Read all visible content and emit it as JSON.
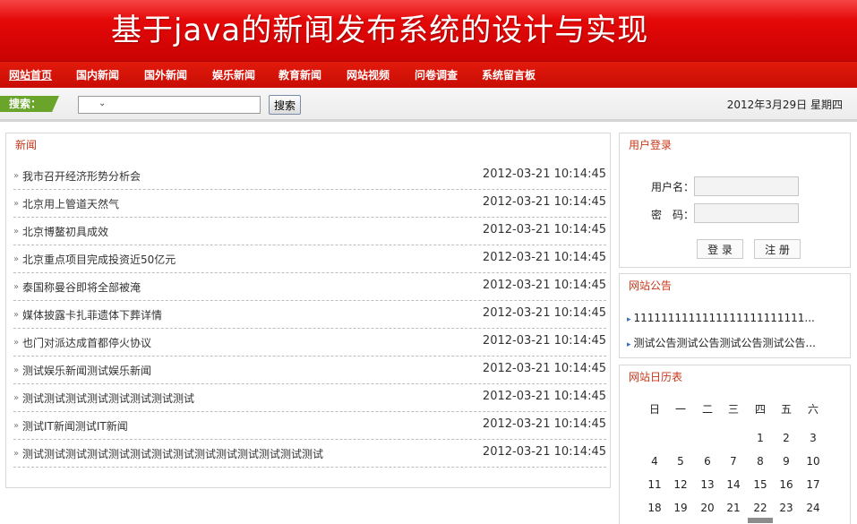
{
  "banner": {
    "title": "基于java的新闻发布系统的设计与实现"
  },
  "nav": {
    "items": [
      "网站首页",
      "国内新闻",
      "国外新闻",
      "娱乐新闻",
      "教育新闻",
      "网站视频",
      "问卷调查",
      "系统留言板"
    ]
  },
  "search": {
    "tag": "搜索：",
    "button": "搜索",
    "date": "2012年3月29日 星期四"
  },
  "news": {
    "title": "新闻",
    "items": [
      {
        "title": "我市召开经济形势分析会",
        "time": "2012-03-21 10:14:45"
      },
      {
        "title": "北京用上管道天然气",
        "time": "2012-03-21 10:14:45"
      },
      {
        "title": "北京博鳌初具成效",
        "time": "2012-03-21 10:14:45"
      },
      {
        "title": "北京重点项目完成投资近50亿元",
        "time": "2012-03-21 10:14:45"
      },
      {
        "title": "泰国称曼谷即将全部被淹",
        "time": "2012-03-21 10:14:45"
      },
      {
        "title": "媒体披露卡扎菲遗体下葬详情",
        "time": "2012-03-21 10:14:45"
      },
      {
        "title": "也门对派达成首都停火协议",
        "time": "2012-03-21 10:14:45"
      },
      {
        "title": "测试娱乐新闻测试娱乐新闻",
        "time": "2012-03-21 10:14:45"
      },
      {
        "title": "测试测试测试测试测试测试测试测试",
        "time": "2012-03-21 10:14:45"
      },
      {
        "title": "测试IT新闻测试IT新闻",
        "time": "2012-03-21 10:14:45"
      },
      {
        "title": "测试测试测试测试测试测试测试测试测试测试测试测试测试测试",
        "time": "2012-03-21 10:14:45"
      }
    ]
  },
  "login": {
    "title": "用户登录",
    "username_label": "用户名：",
    "password_label": "密　码：",
    "login_button": "登 录",
    "register_button": "注 册"
  },
  "notices": {
    "title": "网站公告",
    "items": [
      "1111111111111111111111111...",
      "测试公告测试公告测试公告测试公告..."
    ]
  },
  "calendar": {
    "title": "网站日历表",
    "weekdays": [
      "日",
      "一",
      "二",
      "三",
      "四",
      "五",
      "六"
    ],
    "weeks": [
      [
        "",
        "",
        "",
        "",
        "1",
        "2",
        "3"
      ],
      [
        "4",
        "5",
        "6",
        "7",
        "8",
        "9",
        "10"
      ],
      [
        "11",
        "12",
        "13",
        "14",
        "15",
        "16",
        "17"
      ],
      [
        "18",
        "19",
        "20",
        "21",
        "22",
        "23",
        "24"
      ]
    ],
    "today": "22"
  },
  "colors": {
    "banner": "#e00707",
    "nav": "#c80d04",
    "panel_title": "#c8371a",
    "search_tag": "#6aa42a"
  }
}
